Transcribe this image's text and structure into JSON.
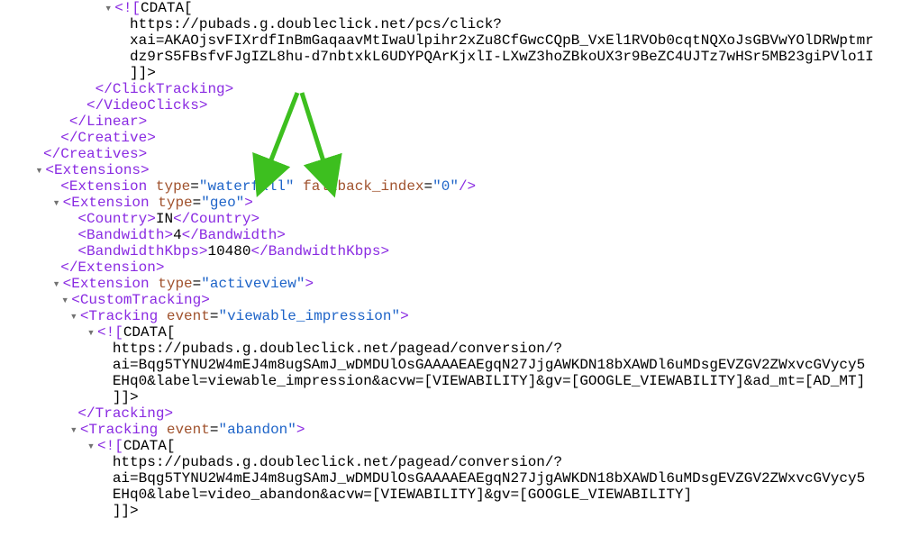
{
  "toggle_glyph": "▼",
  "lines": {
    "l01_prefix": "<![",
    "l01_text": "CDATA[",
    "l02": "https://pubads.g.doubleclick.net/pcs/click?",
    "l03": "xai=AKAOjsvFIXrdfInBmGaqaavMtIwaUlpihr2xZu8CfGwcCQpB_VxEl1RVOb0cqtNQXoJsGBVwYOlDRWptmr",
    "l04": "dz9rS5FBsfvFJgIZL8hu-d7nbtxkL6UDYPQArKjxlI-LXwZ3hoZBkoUX3r9BeZC4UJTz7wHSr5MB23giPVlo1I",
    "l05": "]]>",
    "l06": "</ClickTracking>",
    "l07": "</VideoClicks>",
    "l08": "</Linear>",
    "l09": "</Creative>",
    "l10": "</Creatives>",
    "l11": "<Extensions>",
    "l12_open": "<",
    "l12_tag": "Extension",
    "l12_attr1": "type",
    "l12_val1": "\"waterfall\"",
    "l12_attr2": "fallback_index",
    "l12_val2": "\"0\"",
    "l12_close": "/>",
    "l13_open": "<",
    "l13_tag": "Extension",
    "l13_attr": "type",
    "l13_val": "\"geo\"",
    "l13_close": ">",
    "l14_open": "<",
    "l14_tag": "Country",
    "l14_mid": ">",
    "l14_text": "IN",
    "l14_ctag": "Country",
    "l14_end": ">",
    "l15_open": "<",
    "l15_tag": "Bandwidth",
    "l15_mid": ">",
    "l15_text": "4",
    "l15_ctag": "Bandwidth",
    "l15_end": ">",
    "l16_open": "<",
    "l16_tag": "BandwidthKbps",
    "l16_mid": ">",
    "l16_text": "10480",
    "l16_ctag": "BandwidthKbps",
    "l16_end": ">",
    "l17": "</Extension>",
    "l18_open": "<",
    "l18_tag": "Extension",
    "l18_attr": "type",
    "l18_val": "\"activeview\"",
    "l18_close": ">",
    "l19": "<CustomTracking>",
    "l20_open": "<",
    "l20_tag": "Tracking",
    "l20_attr": "event",
    "l20_val": "\"viewable_impression\"",
    "l20_close": ">",
    "l21_prefix": "<![",
    "l21_text": "CDATA[",
    "l22": "https://pubads.g.doubleclick.net/pagead/conversion/?",
    "l23": "ai=Bqg5TYNU2W4mEJ4m8ugSAmJ_wDMDUlOsGAAAAEAEgqN27JjgAWKDN18bXAWDl6uMDsgEVZGV2ZWxvcGVycy5",
    "l24": "EHq0&label=viewable_impression&acvw=[VIEWABILITY]&gv=[GOOGLE_VIEWABILITY]&ad_mt=[AD_MT]",
    "l25": "]]>",
    "l26": "</Tracking>",
    "l27_open": "<",
    "l27_tag": "Tracking",
    "l27_attr": "event",
    "l27_val": "\"abandon\"",
    "l27_close": ">",
    "l28_prefix": "<![",
    "l28_text": "CDATA[",
    "l29": "https://pubads.g.doubleclick.net/pagead/conversion/?",
    "l30": "ai=Bqg5TYNU2W4mEJ4m8ugSAmJ_wDMDUlOsGAAAAEAEgqN27JjgAWKDN18bXAWDl6uMDsgEVZGV2ZWxvcGVycy5",
    "l31": "EHq0&label=video_abandon&acvw=[VIEWABILITY]&gv=[GOOGLE_VIEWABILITY]",
    "l32": "]]>"
  }
}
